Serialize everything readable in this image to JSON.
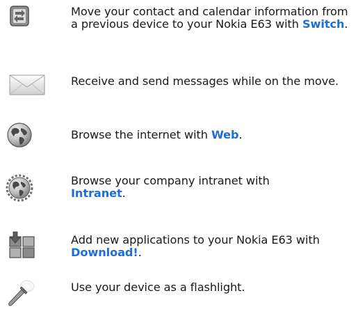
{
  "features": [
    {
      "icon": "switch-icon",
      "text_before": "Move your contact and calendar information from a previous device to your Nokia E63 with ",
      "link": "Switch",
      "text_after": "."
    },
    {
      "icon": "envelope-icon",
      "text_before": "Receive and send messages while on the move.",
      "link": "",
      "text_after": ""
    },
    {
      "icon": "globe-icon",
      "text_before": "Browse the internet with ",
      "link": "Web",
      "text_after": "."
    },
    {
      "icon": "intranet-globe-icon",
      "text_before": "Browse your company intranet with ",
      "link": "Intranet",
      "text_after": "."
    },
    {
      "icon": "download-apps-icon",
      "text_before": "Add new applications to your Nokia E63 with ",
      "link": "Download!",
      "text_after": "."
    },
    {
      "icon": "flashlight-icon",
      "text_before": "Use your device as a flashlight.",
      "link": "",
      "text_after": ""
    }
  ],
  "colors": {
    "link": "#1d6fd6",
    "text": "#1a1a1a"
  }
}
